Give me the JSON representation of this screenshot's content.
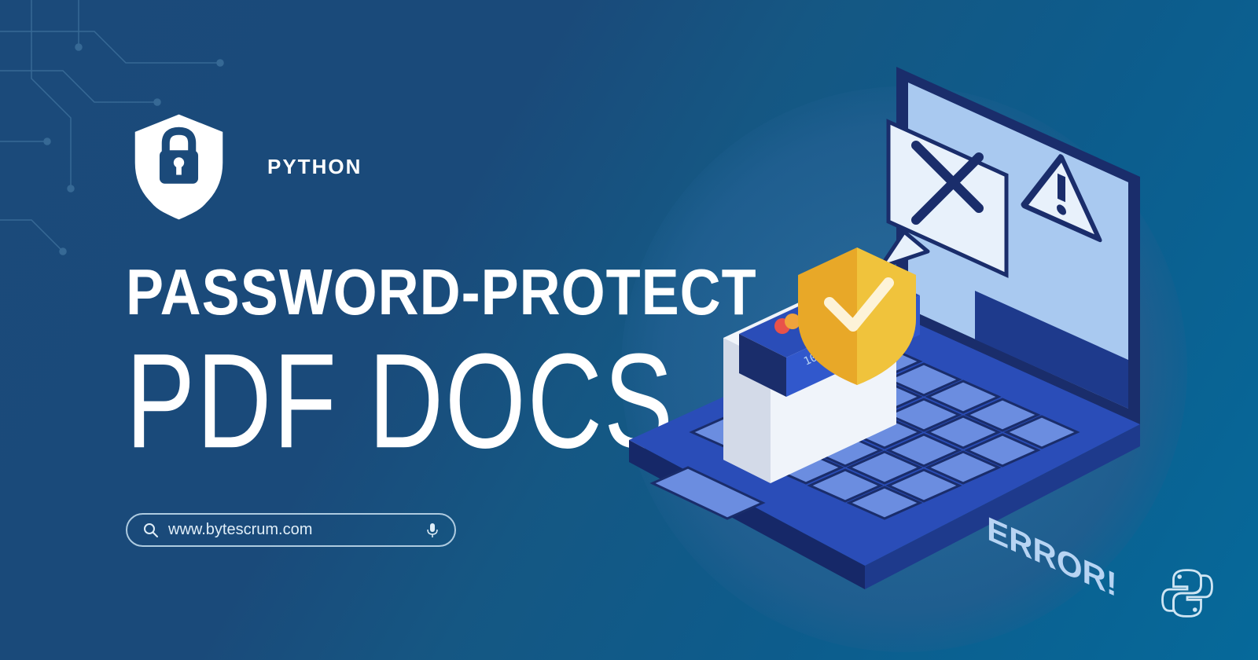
{
  "header": {
    "subtitle": "PYTHON"
  },
  "headline": {
    "line1": "PASSWORD-PROTECT",
    "line2": "PDF DOCS"
  },
  "search": {
    "url": "www.bytescrum.com"
  },
  "illustration": {
    "error_label": "ERROR!",
    "card_number": "1098 7654 3210"
  },
  "colors": {
    "bg_start": "#1b4a7a",
    "bg_end": "#06699a",
    "laptop_body": "#3d5fc9",
    "laptop_dark": "#1a2d6b",
    "screen": "#a9c9f0",
    "error_banner": "#1e3a8c",
    "shield": "#f0c33c",
    "white": "#ffffff"
  }
}
